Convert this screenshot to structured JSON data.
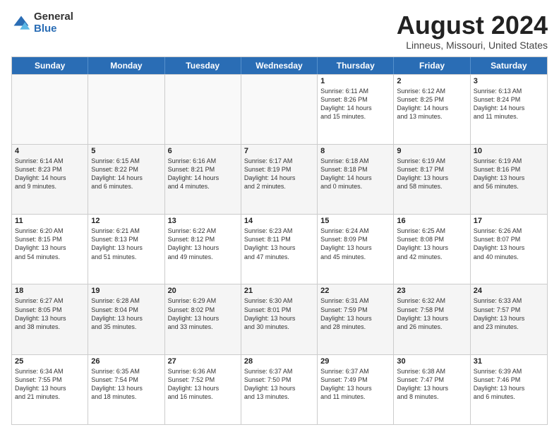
{
  "logo": {
    "general": "General",
    "blue": "Blue"
  },
  "title": {
    "month": "August 2024",
    "location": "Linneus, Missouri, United States"
  },
  "header_days": [
    "Sunday",
    "Monday",
    "Tuesday",
    "Wednesday",
    "Thursday",
    "Friday",
    "Saturday"
  ],
  "weeks": [
    [
      {
        "day": "",
        "info": ""
      },
      {
        "day": "",
        "info": ""
      },
      {
        "day": "",
        "info": ""
      },
      {
        "day": "",
        "info": ""
      },
      {
        "day": "1",
        "info": "Sunrise: 6:11 AM\nSunset: 8:26 PM\nDaylight: 14 hours\nand 15 minutes."
      },
      {
        "day": "2",
        "info": "Sunrise: 6:12 AM\nSunset: 8:25 PM\nDaylight: 14 hours\nand 13 minutes."
      },
      {
        "day": "3",
        "info": "Sunrise: 6:13 AM\nSunset: 8:24 PM\nDaylight: 14 hours\nand 11 minutes."
      }
    ],
    [
      {
        "day": "4",
        "info": "Sunrise: 6:14 AM\nSunset: 8:23 PM\nDaylight: 14 hours\nand 9 minutes."
      },
      {
        "day": "5",
        "info": "Sunrise: 6:15 AM\nSunset: 8:22 PM\nDaylight: 14 hours\nand 6 minutes."
      },
      {
        "day": "6",
        "info": "Sunrise: 6:16 AM\nSunset: 8:21 PM\nDaylight: 14 hours\nand 4 minutes."
      },
      {
        "day": "7",
        "info": "Sunrise: 6:17 AM\nSunset: 8:19 PM\nDaylight: 14 hours\nand 2 minutes."
      },
      {
        "day": "8",
        "info": "Sunrise: 6:18 AM\nSunset: 8:18 PM\nDaylight: 14 hours\nand 0 minutes."
      },
      {
        "day": "9",
        "info": "Sunrise: 6:19 AM\nSunset: 8:17 PM\nDaylight: 13 hours\nand 58 minutes."
      },
      {
        "day": "10",
        "info": "Sunrise: 6:19 AM\nSunset: 8:16 PM\nDaylight: 13 hours\nand 56 minutes."
      }
    ],
    [
      {
        "day": "11",
        "info": "Sunrise: 6:20 AM\nSunset: 8:15 PM\nDaylight: 13 hours\nand 54 minutes."
      },
      {
        "day": "12",
        "info": "Sunrise: 6:21 AM\nSunset: 8:13 PM\nDaylight: 13 hours\nand 51 minutes."
      },
      {
        "day": "13",
        "info": "Sunrise: 6:22 AM\nSunset: 8:12 PM\nDaylight: 13 hours\nand 49 minutes."
      },
      {
        "day": "14",
        "info": "Sunrise: 6:23 AM\nSunset: 8:11 PM\nDaylight: 13 hours\nand 47 minutes."
      },
      {
        "day": "15",
        "info": "Sunrise: 6:24 AM\nSunset: 8:09 PM\nDaylight: 13 hours\nand 45 minutes."
      },
      {
        "day": "16",
        "info": "Sunrise: 6:25 AM\nSunset: 8:08 PM\nDaylight: 13 hours\nand 42 minutes."
      },
      {
        "day": "17",
        "info": "Sunrise: 6:26 AM\nSunset: 8:07 PM\nDaylight: 13 hours\nand 40 minutes."
      }
    ],
    [
      {
        "day": "18",
        "info": "Sunrise: 6:27 AM\nSunset: 8:05 PM\nDaylight: 13 hours\nand 38 minutes."
      },
      {
        "day": "19",
        "info": "Sunrise: 6:28 AM\nSunset: 8:04 PM\nDaylight: 13 hours\nand 35 minutes."
      },
      {
        "day": "20",
        "info": "Sunrise: 6:29 AM\nSunset: 8:02 PM\nDaylight: 13 hours\nand 33 minutes."
      },
      {
        "day": "21",
        "info": "Sunrise: 6:30 AM\nSunset: 8:01 PM\nDaylight: 13 hours\nand 30 minutes."
      },
      {
        "day": "22",
        "info": "Sunrise: 6:31 AM\nSunset: 7:59 PM\nDaylight: 13 hours\nand 28 minutes."
      },
      {
        "day": "23",
        "info": "Sunrise: 6:32 AM\nSunset: 7:58 PM\nDaylight: 13 hours\nand 26 minutes."
      },
      {
        "day": "24",
        "info": "Sunrise: 6:33 AM\nSunset: 7:57 PM\nDaylight: 13 hours\nand 23 minutes."
      }
    ],
    [
      {
        "day": "25",
        "info": "Sunrise: 6:34 AM\nSunset: 7:55 PM\nDaylight: 13 hours\nand 21 minutes."
      },
      {
        "day": "26",
        "info": "Sunrise: 6:35 AM\nSunset: 7:54 PM\nDaylight: 13 hours\nand 18 minutes."
      },
      {
        "day": "27",
        "info": "Sunrise: 6:36 AM\nSunset: 7:52 PM\nDaylight: 13 hours\nand 16 minutes."
      },
      {
        "day": "28",
        "info": "Sunrise: 6:37 AM\nSunset: 7:50 PM\nDaylight: 13 hours\nand 13 minutes."
      },
      {
        "day": "29",
        "info": "Sunrise: 6:37 AM\nSunset: 7:49 PM\nDaylight: 13 hours\nand 11 minutes."
      },
      {
        "day": "30",
        "info": "Sunrise: 6:38 AM\nSunset: 7:47 PM\nDaylight: 13 hours\nand 8 minutes."
      },
      {
        "day": "31",
        "info": "Sunrise: 6:39 AM\nSunset: 7:46 PM\nDaylight: 13 hours\nand 6 minutes."
      }
    ]
  ]
}
